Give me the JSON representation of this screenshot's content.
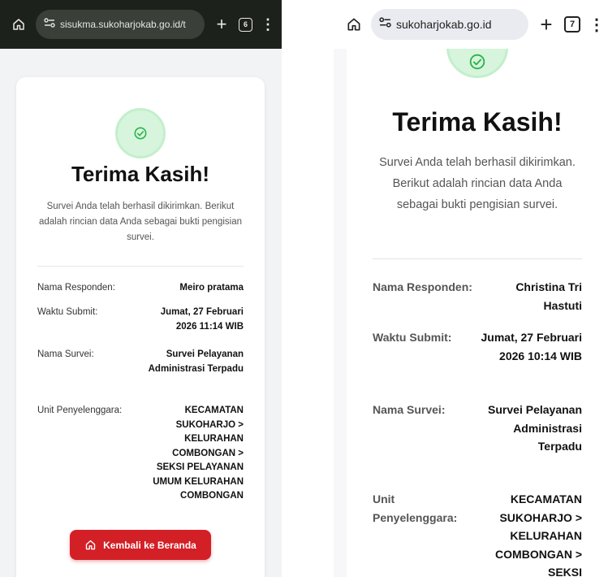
{
  "left": {
    "browser": {
      "url": "sisukma.sukoharjokab.go.id/t",
      "tab_count": "6"
    },
    "title": "Terima Kasih!",
    "message": "Survei Anda telah berhasil dikirimkan. Berikut adalah rincian data Anda sebagai bukti pengisian survei.",
    "details": [
      {
        "label": "Nama Responden:",
        "value": "Meiro pratama"
      },
      {
        "label": "Waktu Submit:",
        "value": "Jumat, 27 Februari 2026 11:14 WIB"
      },
      {
        "label": "Nama Survei:",
        "value": "Survei Pelayanan Administrasi Terpadu"
      },
      {
        "label": "Unit Penyelenggara:",
        "value": "KECAMATAN SUKOHARJO > KELURAHAN COMBONGAN > SEKSI PELAYANAN UMUM KELURAHAN COMBONGAN"
      }
    ],
    "button_label": "Kembali ke Beranda"
  },
  "right": {
    "browser": {
      "url": "sukoharjokab.go.id",
      "tab_count": "7"
    },
    "title": "Terima Kasih!",
    "message": "Survei Anda telah berhasil dikirimkan. Berikut adalah rincian data Anda sebagai bukti pengisian survei.",
    "details": [
      {
        "label": "Nama Responden:",
        "value": "Christina Tri Hastuti"
      },
      {
        "label": "Waktu Submit:",
        "value": "Jumat, 27 Februari 2026 10:14 WIB"
      },
      {
        "label": "Nama Survei:",
        "value": "Survei Pelayanan Administrasi Terpadu"
      },
      {
        "label": "Unit Penyelenggara:",
        "value": "KECAMATAN SUKOHARJO > KELURAHAN COMBONGAN > SEKSI"
      }
    ]
  },
  "colors": {
    "accent_red": "#d32027",
    "success_green": "#2bb24c",
    "success_bg": "#d6f5dc"
  }
}
